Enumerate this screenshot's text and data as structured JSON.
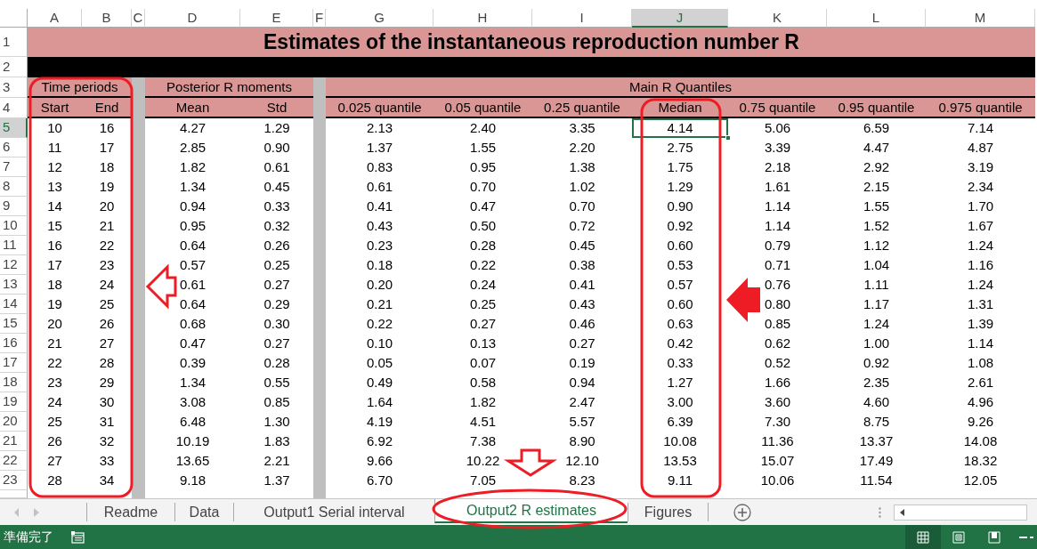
{
  "columns": [
    {
      "letter": "A",
      "selected": false
    },
    {
      "letter": "B",
      "selected": false
    },
    {
      "letter": "C",
      "selected": false
    },
    {
      "letter": "D",
      "selected": false
    },
    {
      "letter": "E",
      "selected": false
    },
    {
      "letter": "F",
      "selected": false
    },
    {
      "letter": "G",
      "selected": false
    },
    {
      "letter": "H",
      "selected": false
    },
    {
      "letter": "I",
      "selected": false
    },
    {
      "letter": "J",
      "selected": true
    },
    {
      "letter": "K",
      "selected": false
    },
    {
      "letter": "L",
      "selected": false
    },
    {
      "letter": "M",
      "selected": false
    }
  ],
  "header_row_numbers": [
    "1",
    "2",
    "3",
    "4"
  ],
  "title": "Estimates of the instantaneous reproduction number R",
  "group_headers": [
    "Time periods",
    "Posterior R moments",
    "Main R Quantiles"
  ],
  "column_headers": [
    "Start",
    "End",
    "Mean",
    "Std",
    "0.025 quantile",
    "0.05 quantile",
    "0.25 quantile",
    "Median",
    "0.75 quantile",
    "0.95 quantile",
    "0.975 quantile"
  ],
  "rows": [
    {
      "number": "5",
      "selected": true,
      "cells": [
        "10",
        "16",
        "4.27",
        "1.29",
        "2.13",
        "2.40",
        "3.35",
        "4.14",
        "5.06",
        "6.59",
        "7.14"
      ]
    },
    {
      "number": "6",
      "selected": false,
      "cells": [
        "11",
        "17",
        "2.85",
        "0.90",
        "1.37",
        "1.55",
        "2.20",
        "2.75",
        "3.39",
        "4.47",
        "4.87"
      ]
    },
    {
      "number": "7",
      "selected": false,
      "cells": [
        "12",
        "18",
        "1.82",
        "0.61",
        "0.83",
        "0.95",
        "1.38",
        "1.75",
        "2.18",
        "2.92",
        "3.19"
      ]
    },
    {
      "number": "8",
      "selected": false,
      "cells": [
        "13",
        "19",
        "1.34",
        "0.45",
        "0.61",
        "0.70",
        "1.02",
        "1.29",
        "1.61",
        "2.15",
        "2.34"
      ]
    },
    {
      "number": "9",
      "selected": false,
      "cells": [
        "14",
        "20",
        "0.94",
        "0.33",
        "0.41",
        "0.47",
        "0.70",
        "0.90",
        "1.14",
        "1.55",
        "1.70"
      ]
    },
    {
      "number": "10",
      "selected": false,
      "cells": [
        "15",
        "21",
        "0.95",
        "0.32",
        "0.43",
        "0.50",
        "0.72",
        "0.92",
        "1.14",
        "1.52",
        "1.67"
      ]
    },
    {
      "number": "11",
      "selected": false,
      "cells": [
        "16",
        "22",
        "0.64",
        "0.26",
        "0.23",
        "0.28",
        "0.45",
        "0.60",
        "0.79",
        "1.12",
        "1.24"
      ]
    },
    {
      "number": "12",
      "selected": false,
      "cells": [
        "17",
        "23",
        "0.57",
        "0.25",
        "0.18",
        "0.22",
        "0.38",
        "0.53",
        "0.71",
        "1.04",
        "1.16"
      ]
    },
    {
      "number": "13",
      "selected": false,
      "cells": [
        "18",
        "24",
        "0.61",
        "0.27",
        "0.20",
        "0.24",
        "0.41",
        "0.57",
        "0.76",
        "1.11",
        "1.24"
      ]
    },
    {
      "number": "14",
      "selected": false,
      "cells": [
        "19",
        "25",
        "0.64",
        "0.29",
        "0.21",
        "0.25",
        "0.43",
        "0.60",
        "0.80",
        "1.17",
        "1.31"
      ]
    },
    {
      "number": "15",
      "selected": false,
      "cells": [
        "20",
        "26",
        "0.68",
        "0.30",
        "0.22",
        "0.27",
        "0.46",
        "0.63",
        "0.85",
        "1.24",
        "1.39"
      ]
    },
    {
      "number": "16",
      "selected": false,
      "cells": [
        "21",
        "27",
        "0.47",
        "0.27",
        "0.10",
        "0.13",
        "0.27",
        "0.42",
        "0.62",
        "1.00",
        "1.14"
      ]
    },
    {
      "number": "17",
      "selected": false,
      "cells": [
        "22",
        "28",
        "0.39",
        "0.28",
        "0.05",
        "0.07",
        "0.19",
        "0.33",
        "0.52",
        "0.92",
        "1.08"
      ]
    },
    {
      "number": "18",
      "selected": false,
      "cells": [
        "23",
        "29",
        "1.34",
        "0.55",
        "0.49",
        "0.58",
        "0.94",
        "1.27",
        "1.66",
        "2.35",
        "2.61"
      ]
    },
    {
      "number": "19",
      "selected": false,
      "cells": [
        "24",
        "30",
        "3.08",
        "0.85",
        "1.64",
        "1.82",
        "2.47",
        "3.00",
        "3.60",
        "4.60",
        "4.96"
      ]
    },
    {
      "number": "20",
      "selected": false,
      "cells": [
        "25",
        "31",
        "6.48",
        "1.30",
        "4.19",
        "4.51",
        "5.57",
        "6.39",
        "7.30",
        "8.75",
        "9.26"
      ]
    },
    {
      "number": "21",
      "selected": false,
      "cells": [
        "26",
        "32",
        "10.19",
        "1.83",
        "6.92",
        "7.38",
        "8.90",
        "10.08",
        "11.36",
        "13.37",
        "14.08"
      ]
    },
    {
      "number": "22",
      "selected": false,
      "cells": [
        "27",
        "33",
        "13.65",
        "2.21",
        "9.66",
        "10.22",
        "12.10",
        "13.53",
        "15.07",
        "17.49",
        "18.32"
      ]
    },
    {
      "number": "23",
      "selected": false,
      "cells": [
        "28",
        "34",
        "9.18",
        "1.37",
        "6.70",
        "7.05",
        "8.23",
        "9.11",
        "10.06",
        "11.54",
        "12.05"
      ]
    }
  ],
  "sheet_tabs": [
    {
      "label": "Readme",
      "selected": false
    },
    {
      "label": "Data",
      "selected": false
    },
    {
      "label": "Output1 Serial interval",
      "selected": false
    },
    {
      "label": "Output2 R estimates",
      "selected": true
    },
    {
      "label": "Figures",
      "selected": false
    }
  ],
  "status_bar": {
    "text": "準備完了",
    "view_buttons": [
      {
        "kind": "normal",
        "selected": true
      },
      {
        "kind": "page_layout",
        "selected": false
      },
      {
        "kind": "page_break",
        "selected": false
      }
    ]
  }
}
